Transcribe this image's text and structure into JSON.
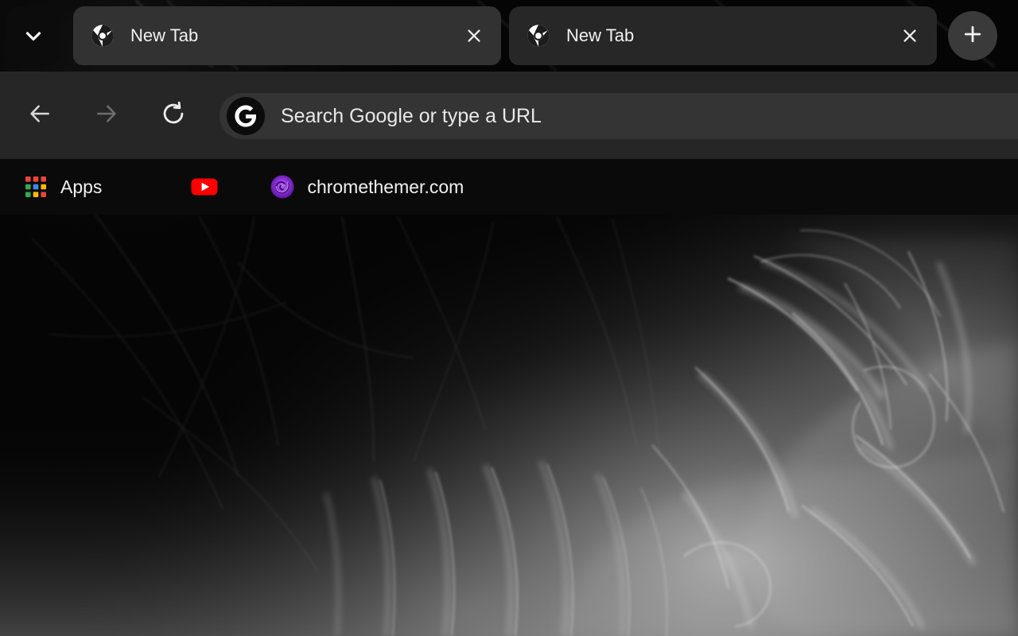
{
  "window": {
    "title": "New Tab",
    "theme_name": "smoke-dark"
  },
  "colors": {
    "tabstrip_bg": "#0a0a0a",
    "active_tab_bg": "#323232",
    "inactive_tab_bg": "#272727",
    "toolbar_bg": "#262626",
    "omnibox_bg": "#343434",
    "bookmarks_bg": "#0a0a0a",
    "text_primary": "#f1f1f1",
    "icon_enabled": "#e0e0e0",
    "icon_disabled": "#6e6e6e",
    "new_tab_btn_bg": "#3a3a3a",
    "youtube_red": "#ff0000",
    "chromethemer_purple": "#8b2fd6",
    "apps_red": "#e8453c",
    "apps_green": "#34a853",
    "apps_blue": "#4285f4",
    "apps_yellow": "#fabb05"
  },
  "tabstrip": {
    "tab_search_label": "Search tabs",
    "tab_search_icon": "chevron-down-icon",
    "new_tab_label": "New tab",
    "new_tab_icon": "plus-icon",
    "tabs": [
      {
        "title": "New Tab",
        "favicon": "chrome-logo-icon",
        "active": true,
        "close_label": "Close",
        "close_icon": "close-icon"
      },
      {
        "title": "New Tab",
        "favicon": "chrome-logo-icon",
        "active": false,
        "close_label": "Close",
        "close_icon": "close-icon"
      }
    ]
  },
  "toolbar": {
    "back_label": "Back",
    "back_icon": "arrow-left-icon",
    "back_enabled": true,
    "forward_label": "Forward",
    "forward_icon": "arrow-right-icon",
    "forward_enabled": false,
    "reload_label": "Reload",
    "reload_icon": "reload-icon"
  },
  "omnibox": {
    "search_icon": "google-g-icon",
    "value": "",
    "placeholder": "Search Google or type a URL"
  },
  "bookmarks": {
    "items": [
      {
        "label": "Apps",
        "icon": "apps-grid-icon"
      },
      {
        "label": "",
        "icon": "youtube-icon"
      },
      {
        "label": "chromethemer.com",
        "icon": "chromethemer-swirl-icon"
      }
    ]
  },
  "content": {
    "description": "New Tab page showing dark smoke theme background image"
  }
}
